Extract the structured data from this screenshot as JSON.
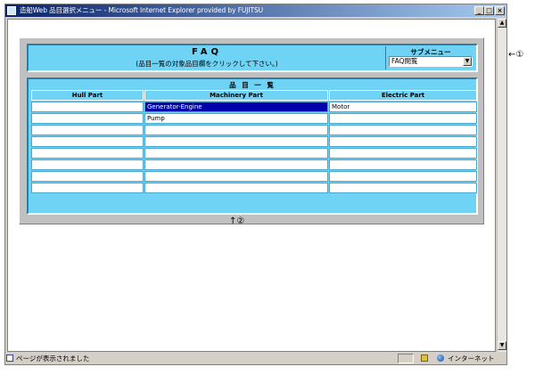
{
  "window": {
    "title": "造船Web 品目選択メニュー - Microsoft Internet Explorer provided by FUJITSU",
    "minimize_glyph": "_",
    "maximize_glyph": "□",
    "close_glyph": "×"
  },
  "faq": {
    "title": "FAQ",
    "subtitle": "(品目一覧の対象品目欄をクリックして下さい。)",
    "submenu_label": "サブメニュー",
    "submenu_selected": "FAQ閲覧"
  },
  "item_list": {
    "title": "品 目 一 覧",
    "columns": [
      "Hull Part",
      "Machinery Part",
      "Electric Part"
    ],
    "rows": [
      [
        "",
        "Generator-Engine",
        "Motor"
      ],
      [
        "",
        "Pump",
        ""
      ],
      [
        "",
        "",
        ""
      ],
      [
        "",
        "",
        ""
      ],
      [
        "",
        "",
        ""
      ],
      [
        "",
        "",
        ""
      ],
      [
        "",
        "",
        ""
      ],
      [
        "",
        "",
        ""
      ]
    ],
    "selected_row": 0,
    "selected_col": 1
  },
  "statusbar": {
    "message": "ページが表示されました",
    "zone": "インターネット"
  },
  "annotations": {
    "right": "←①",
    "bottom": "↑②"
  },
  "colors": {
    "panel_cyan": "#6fd3f5",
    "selection": "#0000aa",
    "titlebar": "#0a246a"
  },
  "icons": [
    "ie-page-icon",
    "minimize-icon",
    "maximize-icon",
    "close-icon",
    "scroll-up-icon",
    "scroll-down-icon",
    "dropdown-arrow-icon",
    "status-page-icon",
    "lock-icon",
    "internet-zone-icon"
  ]
}
